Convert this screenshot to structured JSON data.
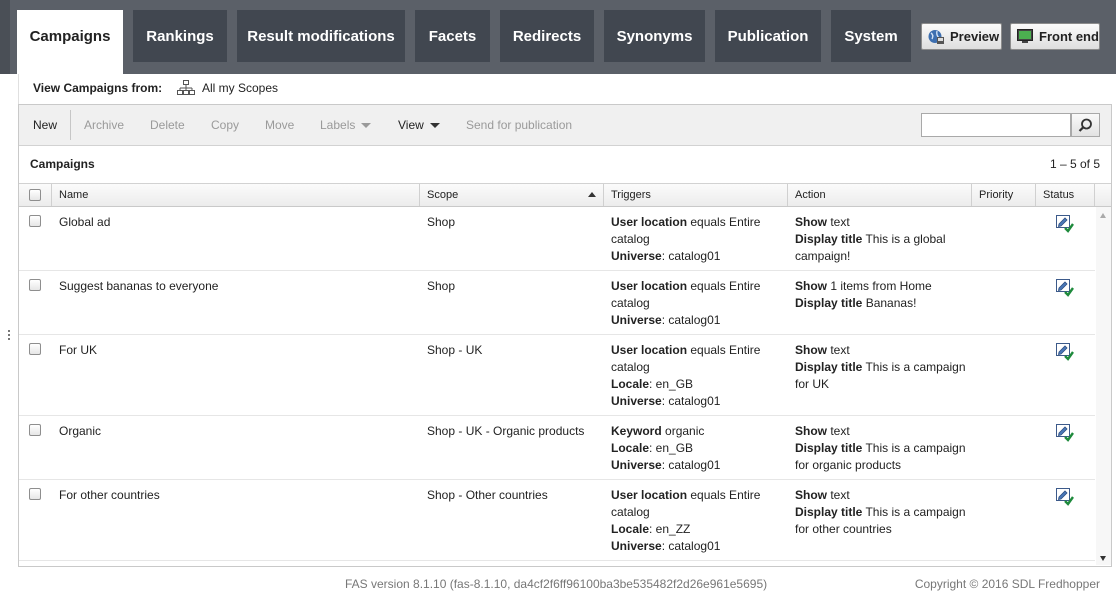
{
  "nav": {
    "tabs": [
      "Campaigns",
      "Rankings",
      "Result modifications",
      "Facets",
      "Redirects",
      "Synonyms",
      "Publication",
      "System"
    ],
    "active_tab": "Campaigns",
    "preview_label": "Preview",
    "frontend_label": "Front end"
  },
  "scope": {
    "label": "View Campaigns from:",
    "value": "All my Scopes"
  },
  "toolbar": {
    "new": "New",
    "archive": "Archive",
    "delete": "Delete",
    "copy": "Copy",
    "move": "Move",
    "labels": "Labels",
    "view": "View",
    "send": "Send for publication",
    "search_value": ""
  },
  "grid": {
    "title": "Campaigns",
    "paging": "1 – 5 of 5",
    "columns": [
      "Name",
      "Scope",
      "Triggers",
      "Action",
      "Priority",
      "Status"
    ],
    "sorted_column": "Scope",
    "rows": [
      {
        "name": "Global ad",
        "scope": "Shop",
        "triggers": [
          {
            "key": "User location",
            "text": " equals Entire catalog"
          },
          {
            "key": "Universe",
            "text": ": catalog01"
          }
        ],
        "action": [
          {
            "key": "Show",
            "text": " text"
          },
          {
            "key": "Display title",
            "text": " This is a global campaign!"
          }
        ],
        "priority": "",
        "status_icon": "published-check-icon"
      },
      {
        "name": "Suggest bananas to everyone",
        "scope": "Shop",
        "triggers": [
          {
            "key": "User location",
            "text": " equals Entire catalog"
          },
          {
            "key": "Universe",
            "text": ": catalog01"
          }
        ],
        "action": [
          {
            "key": "Show",
            "text": " 1 items from Home"
          },
          {
            "key": "Display title",
            "text": " Bananas!"
          }
        ],
        "priority": "",
        "status_icon": "published-check-icon"
      },
      {
        "name": "For UK",
        "scope": "Shop - UK",
        "triggers": [
          {
            "key": "User location",
            "text": " equals Entire catalog"
          },
          {
            "key": "Locale",
            "text": ": en_GB"
          },
          {
            "key": "Universe",
            "text": ": catalog01"
          }
        ],
        "action": [
          {
            "key": "Show",
            "text": " text"
          },
          {
            "key": "Display title",
            "text": " This is a campaign for UK"
          }
        ],
        "priority": "",
        "status_icon": "published-check-icon"
      },
      {
        "name": "Organic",
        "scope": "Shop - UK - Organic products",
        "triggers": [
          {
            "key": "Keyword",
            "text": " organic"
          },
          {
            "key": "Locale",
            "text": ": en_GB"
          },
          {
            "key": "Universe",
            "text": ": catalog01"
          }
        ],
        "action": [
          {
            "key": "Show",
            "text": " text"
          },
          {
            "key": "Display title",
            "text": " This is a campaign for organic products"
          }
        ],
        "priority": "",
        "status_icon": "published-check-icon"
      },
      {
        "name": "For other countries",
        "scope": "Shop - Other countries",
        "triggers": [
          {
            "key": "User location",
            "text": " equals Entire catalog"
          },
          {
            "key": "Locale",
            "text": ": en_ZZ"
          },
          {
            "key": "Universe",
            "text": ": catalog01"
          }
        ],
        "action": [
          {
            "key": "Show",
            "text": " text"
          },
          {
            "key": "Display title",
            "text": " This is a campaign for other countries"
          }
        ],
        "priority": "",
        "status_icon": "published-check-icon"
      }
    ]
  },
  "footer": {
    "version": "FAS version 8.1.10 (fas-8.1.10, da4cf2f6ff96100ba3be535482f2d26e961e5695)",
    "copyright": "Copyright © 2016 SDL Fredhopper"
  },
  "colors": {
    "nav_bg": "#5b6068",
    "tab_bg": "#414750",
    "status_check": "#1e8a3c"
  }
}
